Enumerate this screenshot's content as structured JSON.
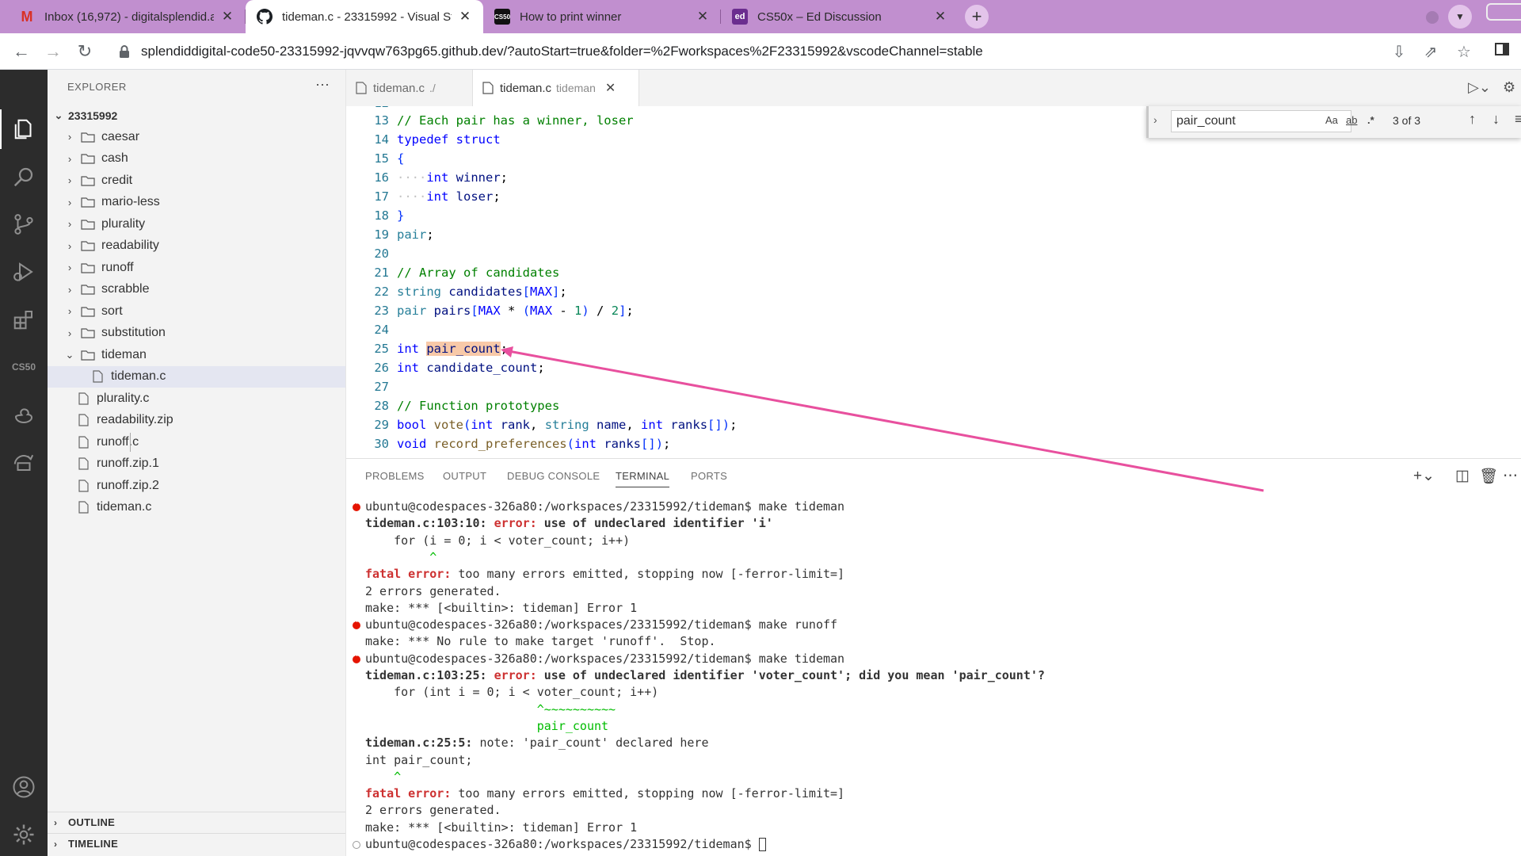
{
  "browser": {
    "tabs": [
      {
        "title": "Inbox (16,972) - digitalsplendid.a",
        "icon": "gmail-icon",
        "favicon_text": "M"
      },
      {
        "title": "tideman.c - 23315992 - Visual St",
        "icon": "github-icon",
        "favicon_text": ""
      },
      {
        "title": "How to print winner",
        "icon": "cs50-icon",
        "favicon_text": "CS50"
      },
      {
        "title": "CS50x – Ed Discussion",
        "icon": "ed-icon",
        "favicon_text": "ed"
      }
    ],
    "close_glyph": "✕",
    "new_tab": "+",
    "url": "splendiddigital-code50-23315992-jqvvqw763pg65.github.dev/?autoStart=true&folder=%2Fworkspaces%2F23315992&vscodeChannel=stable"
  },
  "activity_bar": {
    "items": [
      "explorer-icon",
      "search-icon",
      "source-control-icon",
      "run-debug-icon",
      "extensions-icon",
      "cs50-icon",
      "duck-icon",
      "remote-icon"
    ],
    "cs50_label": "CS50",
    "bottom": [
      "account-icon",
      "manage-gear-icon"
    ]
  },
  "explorer": {
    "title": "EXPLORER",
    "more": "···",
    "root": "23315992",
    "folders": [
      "caesar",
      "cash",
      "credit",
      "mario-less",
      "plurality",
      "readability",
      "runoff",
      "scrabble",
      "sort",
      "substitution"
    ],
    "open_folder": "tideman",
    "open_folder_children": [
      "tideman.c"
    ],
    "files": [
      "plurality.c",
      "readability.zip",
      "runoff.c",
      "runoff.zip.1",
      "runoff.zip.2",
      "tideman.c"
    ],
    "outline": "OUTLINE",
    "timeline": "TIMELINE"
  },
  "editor_tabs": [
    {
      "label": "tideman.c",
      "desc": "./",
      "active": false
    },
    {
      "label": "tideman.c",
      "desc": "tideman",
      "active": true
    }
  ],
  "find": {
    "query": "pair_count",
    "match_case": "Aa",
    "whole_word": "ab",
    "regex": ".*",
    "count": "3 of 3"
  },
  "code_lines": [
    {
      "n": "13",
      "html": "<span class=\"cm\">// Each pair has a winner, loser</span>"
    },
    {
      "n": "14",
      "html": "<span class=\"kw\">typedef</span> <span class=\"kw\">struct</span>"
    },
    {
      "n": "15",
      "html": "<span class=\"br\">{</span>"
    },
    {
      "n": "16",
      "html": "<span class=\"ws\">····</span><span class=\"kw\">int</span> <span class=\"vr\">winner</span>;"
    },
    {
      "n": "17",
      "html": "<span class=\"ws\">····</span><span class=\"kw\">int</span> <span class=\"vr\">loser</span>;"
    },
    {
      "n": "18",
      "html": "<span class=\"br\">}</span>"
    },
    {
      "n": "19",
      "html": "<span class=\"ty\">pair</span>;"
    },
    {
      "n": "20",
      "html": ""
    },
    {
      "n": "21",
      "html": "<span class=\"cm\">// Array of candidates</span>"
    },
    {
      "n": "22",
      "html": "<span class=\"ty\">string</span> <span class=\"vr\">candidates</span><span class=\"br\">[</span><span class=\"kw\">MAX</span><span class=\"br\">]</span>;"
    },
    {
      "n": "23",
      "html": "<span class=\"ty\">pair</span> <span class=\"vr\">pairs</span><span class=\"br\">[</span><span class=\"kw\">MAX</span> * <span class=\"br\">(</span><span class=\"kw\">MAX</span> - <span class=\"nm\">1</span><span class=\"br\">)</span> / <span class=\"nm\">2</span><span class=\"br\">]</span>;"
    },
    {
      "n": "24",
      "html": ""
    },
    {
      "n": "25",
      "html": "<span class=\"kw\">int</span> <span class=\"vr hl\">pair_count</span>;"
    },
    {
      "n": "26",
      "html": "<span class=\"kw\">int</span> <span class=\"vr\">candidate_count</span>;"
    },
    {
      "n": "27",
      "html": ""
    },
    {
      "n": "28",
      "html": "<span class=\"cm\">// Function prototypes</span>"
    },
    {
      "n": "29",
      "html": "<span class=\"kw\">bool</span> <span class=\"fn\">vote</span><span class=\"br\">(</span><span class=\"kw\">int</span> <span class=\"vr\">rank</span>, <span class=\"ty\">string</span> <span class=\"vr\">name</span>, <span class=\"kw\">int</span> <span class=\"vr\">ranks</span><span class=\"br\">[]</span><span class=\"br\">)</span>;"
    },
    {
      "n": "30",
      "html": "<span class=\"kw\">void</span> <span class=\"fn\">record_preferences</span><span class=\"br\">(</span><span class=\"kw\">int</span> <span class=\"vr\">ranks</span><span class=\"br\">[]</span><span class=\"br\">)</span>;"
    }
  ],
  "panel": {
    "tabs": [
      "PROBLEMS",
      "OUTPUT",
      "DEBUG CONSOLE",
      "TERMINAL",
      "PORTS"
    ],
    "active_tab": "TERMINAL"
  },
  "terminal_lines": [
    {
      "deco": "err",
      "html": "ubuntu@codespaces-326a80:/workspaces/23315992/tideman$ make tideman"
    },
    {
      "deco": "",
      "html": "<span class=\"b\">tideman.c:103:10: </span><span class=\"red\">error:</span><span class=\"b\"> use of undeclared identifier 'i'</span>"
    },
    {
      "deco": "",
      "html": "    for (i = 0; i &lt; voter_count; i++)"
    },
    {
      "deco": "",
      "html": "         <span class=\"grn\">^</span>"
    },
    {
      "deco": "",
      "html": "<span class=\"red\">fatal error:</span> too many errors emitted, stopping now [-ferror-limit=]"
    },
    {
      "deco": "",
      "html": "2 errors generated."
    },
    {
      "deco": "",
      "html": "make: *** [&lt;builtin&gt;: tideman] Error 1"
    },
    {
      "deco": "err",
      "html": "ubuntu@codespaces-326a80:/workspaces/23315992/tideman$ make runoff"
    },
    {
      "deco": "",
      "html": "make: *** No rule to make target 'runoff'.  Stop."
    },
    {
      "deco": "err",
      "html": "ubuntu@codespaces-326a80:/workspaces/23315992/tideman$ make tideman"
    },
    {
      "deco": "",
      "html": "<span class=\"b\">tideman.c:103:25: </span><span class=\"red\">error:</span><span class=\"b\"> use of undeclared identifier 'voter_count'; did you mean 'pair_count'?</span>"
    },
    {
      "deco": "",
      "html": "    for (int i = 0; i &lt; voter_count; i++)"
    },
    {
      "deco": "",
      "html": "                        <span class=\"grn\">^~~~~~~~~~~</span>"
    },
    {
      "deco": "",
      "html": "                        <span class=\"grn\">pair_count</span>"
    },
    {
      "deco": "",
      "html": "<span class=\"b\">tideman.c:25:5: </span>note: 'pair_count' declared here"
    },
    {
      "deco": "",
      "html": "int pair_count;"
    },
    {
      "deco": "",
      "html": "    <span class=\"grn\">^</span>"
    },
    {
      "deco": "",
      "html": "<span class=\"red\">fatal error:</span> too many errors emitted, stopping now [-ferror-limit=]"
    },
    {
      "deco": "",
      "html": "2 errors generated."
    },
    {
      "deco": "",
      "html": "make: *** [&lt;builtin&gt;: tideman] Error 1"
    },
    {
      "deco": "idle",
      "html": "ubuntu@codespaces-326a80:/workspaces/23315992/tideman$ <span class=\"cursor\"></span>"
    }
  ],
  "colors": {
    "browser_frame": "#c18fcf",
    "activity_bar": "#2c2c2c",
    "annotation_arrow": "#e8509e",
    "search_highlight": "#f8c9a8"
  }
}
